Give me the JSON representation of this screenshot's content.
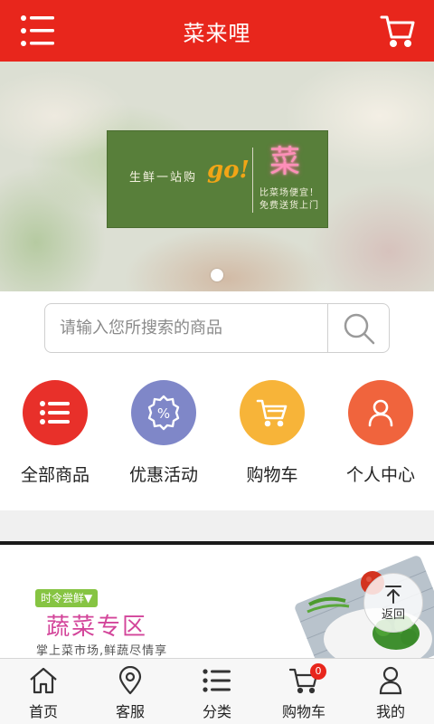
{
  "header": {
    "title": "菜来哩",
    "menu_icon": "menu-icon",
    "cart_icon": "cart-icon"
  },
  "banner": {
    "slogan": "生鲜一站购",
    "slogan_go": "go!",
    "brand_char": "菜",
    "line1": "比菜场便宜！",
    "line2": "免费送货上门",
    "page_indicator": {
      "current": 1,
      "total": 1
    }
  },
  "search": {
    "placeholder": "请输入您所搜索的商品",
    "value": "",
    "button_icon": "search-icon"
  },
  "quick_nav": [
    {
      "label": "全部商品",
      "icon": "list-icon",
      "color": "#e8302a"
    },
    {
      "label": "优惠活动",
      "icon": "discount-icon",
      "color": "#7f87c8"
    },
    {
      "label": "购物车",
      "icon": "cart-icon",
      "color": "#f7b439"
    },
    {
      "label": "个人中心",
      "icon": "user-icon",
      "color": "#f0643d"
    }
  ],
  "veg_section": {
    "tag": "时令尝鲜▼",
    "title": "蔬菜专区",
    "subtitle": "掌上菜市场,鲜蔬尽情享"
  },
  "back_button": {
    "label": "返回",
    "icon": "arrow-up-icon"
  },
  "bottom_nav": [
    {
      "label": "首页",
      "icon": "home-icon"
    },
    {
      "label": "客服",
      "icon": "location-icon"
    },
    {
      "label": "分类",
      "icon": "list-icon"
    },
    {
      "label": "购物车",
      "icon": "cart-icon",
      "badge": "0"
    },
    {
      "label": "我的",
      "icon": "user-icon"
    }
  ],
  "colors": {
    "brand": "#e8261c",
    "veg_title": "#d3459a",
    "veg_tag": "#86c442"
  }
}
